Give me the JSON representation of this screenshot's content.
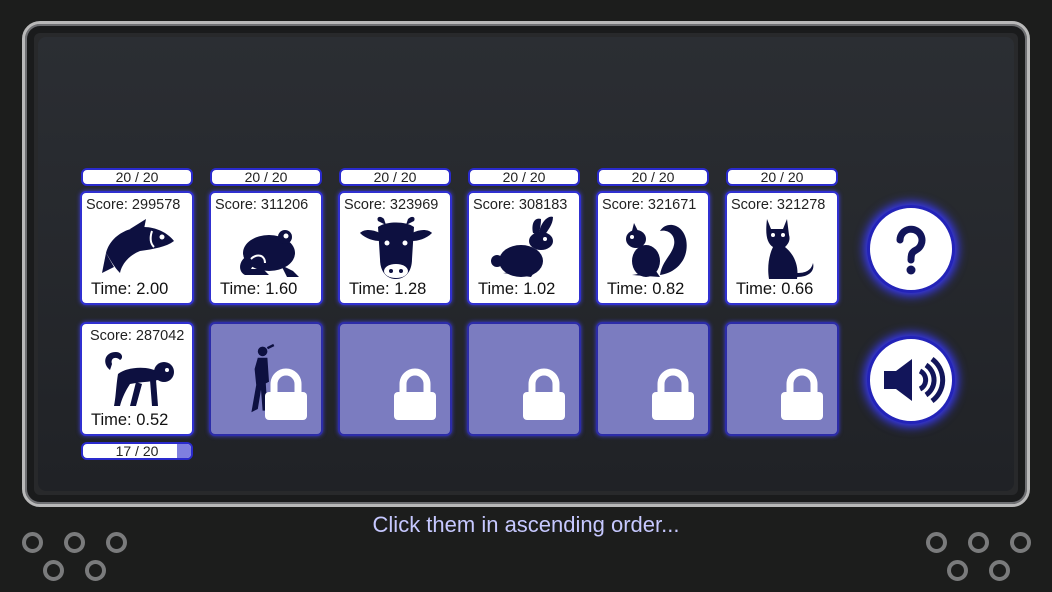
{
  "levels": [
    {
      "progress": "20 / 20",
      "progress_fraction": 1.0,
      "score": "Score: 299578",
      "time": "Time: 2.00",
      "animal": "fish-icon"
    },
    {
      "progress": "20 / 20",
      "progress_fraction": 1.0,
      "score": "Score: 311206",
      "time": "Time: 1.60",
      "animal": "frog-icon"
    },
    {
      "progress": "20 / 20",
      "progress_fraction": 1.0,
      "score": "Score: 323969",
      "time": "Time: 1.28",
      "animal": "cow-icon"
    },
    {
      "progress": "20 / 20",
      "progress_fraction": 1.0,
      "score": "Score: 308183",
      "time": "Time: 1.02",
      "animal": "rabbit-icon"
    },
    {
      "progress": "20 / 20",
      "progress_fraction": 1.0,
      "score": "Score: 321671",
      "time": "Time: 0.82",
      "animal": "squirrel-icon"
    },
    {
      "progress": "20 / 20",
      "progress_fraction": 1.0,
      "score": "Score: 321278",
      "time": "Time: 0.66",
      "animal": "cat-icon"
    },
    {
      "progress": "17 / 20",
      "progress_fraction": 0.85,
      "score": "Score: 287042",
      "time": "Time: 0.52",
      "animal": "monkey-icon"
    }
  ],
  "locked_levels": [
    {
      "silhouette": "human-icon"
    },
    {
      "silhouette": ""
    },
    {
      "silhouette": ""
    },
    {
      "silhouette": ""
    },
    {
      "silhouette": ""
    }
  ],
  "buttons": {
    "help": "question-icon",
    "sound": "speaker-icon"
  },
  "hint_text": "Click them in ascending order...",
  "colors": {
    "accent": "#2a2acc",
    "locked": "#7b7cc0",
    "hint": "#c6c8ff",
    "icon": "#0d1040"
  }
}
